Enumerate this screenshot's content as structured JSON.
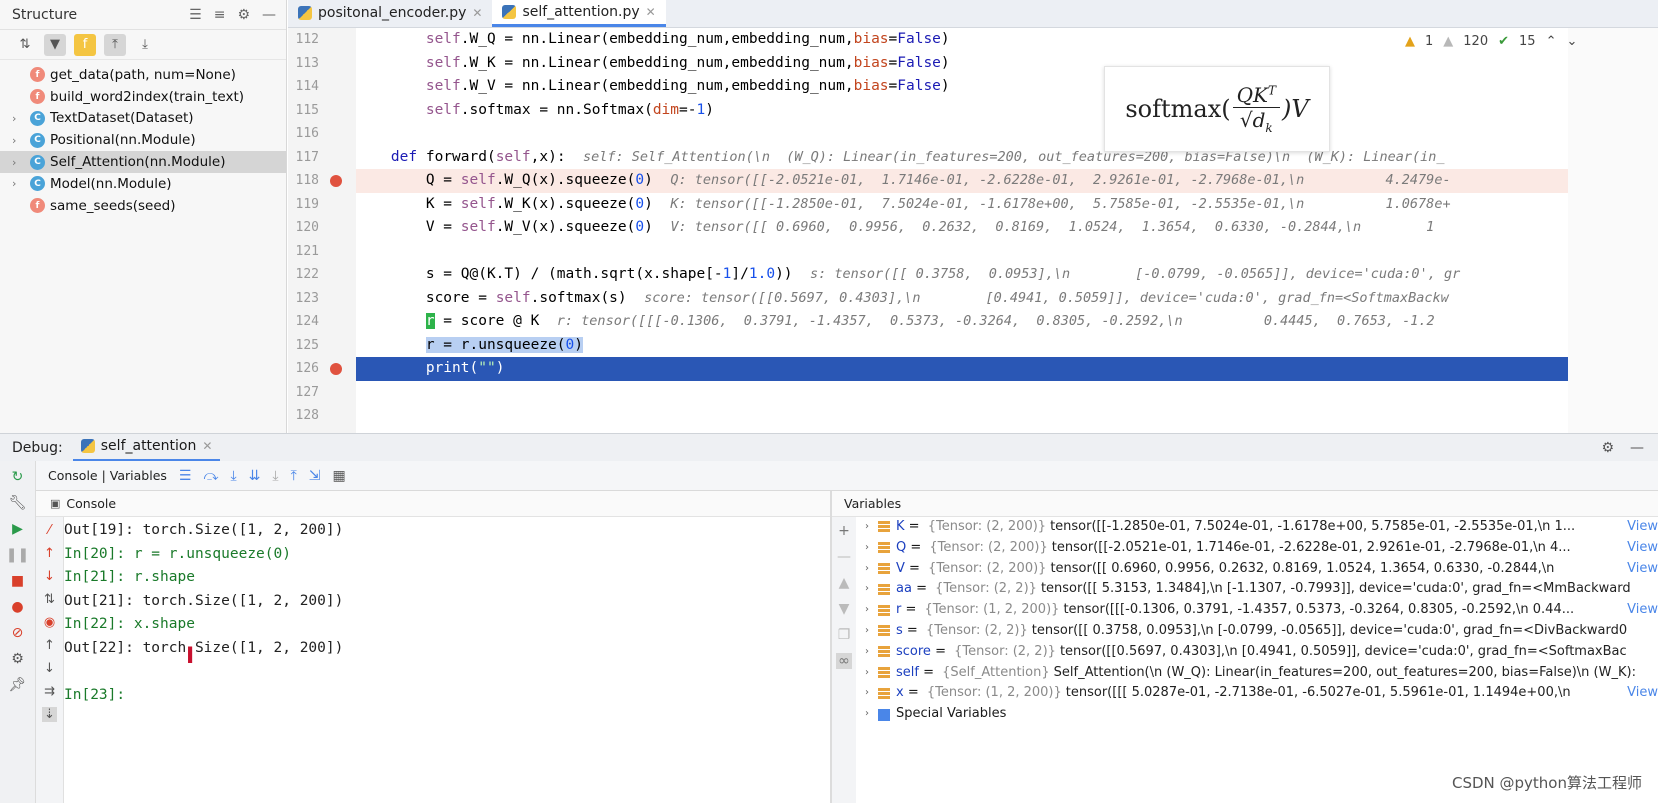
{
  "structure": {
    "title": "Structure",
    "items": [
      {
        "kind": "f",
        "label": "get_data(path, num=None)",
        "expand": ""
      },
      {
        "kind": "f",
        "label": "build_word2index(train_text)",
        "expand": ""
      },
      {
        "kind": "c",
        "label": "TextDataset(Dataset)",
        "expand": "›"
      },
      {
        "kind": "c",
        "label": "Positional(nn.Module)",
        "expand": "›"
      },
      {
        "kind": "c",
        "label": "Self_Attention(nn.Module)",
        "expand": "›"
      },
      {
        "kind": "c",
        "label": "Model(nn.Module)",
        "expand": "›"
      },
      {
        "kind": "f",
        "label": "same_seeds(seed)",
        "expand": ""
      }
    ]
  },
  "editor": {
    "tabs": [
      {
        "label": "positonal_encoder.py"
      },
      {
        "label": "self_attention.py"
      }
    ],
    "inspections": {
      "warnings": "1",
      "weak_warnings": "120",
      "ok": "15"
    },
    "line_numbers": [
      "112",
      "113",
      "114",
      "115",
      "116",
      "117",
      "118",
      "119",
      "120",
      "121",
      "122",
      "123",
      "124",
      "125",
      "126",
      "127",
      "128"
    ],
    "inline_values": {
      "forward": "self: Self_Attention(\\n  (W_Q): Linear(in_features=200, out_features=200, bias=False)\\n  (W_K): Linear(in_",
      "Q": "Q: tensor([[-2.0521e-01,  1.7146e-01, -2.6228e-01,  2.9261e-01, -2.7968e-01,\\n          4.2479e-",
      "K": "K: tensor([[-1.2850e-01,  7.5024e-01, -1.6178e+00,  5.7585e-01, -2.5535e-01,\\n          1.0678e+",
      "V": "V: tensor([[ 0.6960,  0.9956,  0.2632,  0.8169,  1.0524,  1.3654,  0.6330, -0.2844,\\n        1",
      "s": "s: tensor([[ 0.3758,  0.0953],\\n        [-0.0799, -0.0565]], device='cuda:0', gr",
      "score": "score: tensor([[0.5697, 0.4303],\\n        [0.4941, 0.5059]], device='cuda:0', grad_fn=<SoftmaxBackw",
      "r": "r: tensor([[[-0.1306,  0.3791, -1.4357,  0.5373, -0.3264,  0.8305, -0.2592,\\n          0.4445,  0.7653, -1.2"
    },
    "formula": {
      "word": "softmax(",
      "numerator": "QK",
      "sup": "T",
      "denominator": "√d",
      "sub": "k",
      "tail": ")V"
    }
  },
  "debug": {
    "label": "Debug:",
    "tab": "self_attention",
    "subbar": "Console | Variables",
    "console_header": "Console",
    "variables_header": "Variables",
    "console_lines": [
      {
        "type": "out",
        "text": "Out[19]: torch.Size([1, 2, 200])"
      },
      {
        "type": "in",
        "text": "In[20]: r = r.unsqueeze(0)"
      },
      {
        "type": "in",
        "text": "In[21]: r.shape"
      },
      {
        "type": "out",
        "text": "Out[21]: torch.Size([1, 2, 200])"
      },
      {
        "type": "in",
        "text": "In[22]: x.shape"
      },
      {
        "type": "out",
        "text": "Out[22]: torch.Size([1, 2, 200])"
      },
      {
        "type": "blank",
        "text": ""
      },
      {
        "type": "in",
        "text": "In[23]:"
      }
    ],
    "variables": [
      {
        "name": "K",
        "type": "{Tensor: (2, 200)}",
        "value": "tensor([[-1.2850e-01,  7.5024e-01, -1.6178e+00,  5.7585e-01, -2.5535e-01,\\n        1...",
        "view": "View"
      },
      {
        "name": "Q",
        "type": "{Tensor: (2, 200)}",
        "value": "tensor([[-2.0521e-01,  1.7146e-01, -2.6228e-01,  2.9261e-01, -2.7968e-01,\\n        4...",
        "view": "View"
      },
      {
        "name": "V",
        "type": "{Tensor: (2, 200)}",
        "value": "tensor([[ 0.6960,  0.9956,  0.2632,  0.8169,  1.0524,  1.3654,  0.6330, -0.2844,\\n",
        "view": "View"
      },
      {
        "name": "aa",
        "type": "{Tensor: (2, 2)}",
        "value": "tensor([[ 5.3153,  1.3484],\\n        [-1.1307, -0.7993]], device='cuda:0', grad_fn=<MmBackward",
        "view": ""
      },
      {
        "name": "r",
        "type": "{Tensor: (1, 2, 200)}",
        "value": "tensor([[[-0.1306,  0.3791, -1.4357,  0.5373, -0.3264,  0.8305, -0.2592,\\n          0.44...",
        "view": "View"
      },
      {
        "name": "s",
        "type": "{Tensor: (2, 2)}",
        "value": "tensor([[ 0.3758,  0.0953],\\n        [-0.0799, -0.0565]], device='cuda:0', grad_fn=<DivBackward0",
        "view": ""
      },
      {
        "name": "score",
        "type": "{Tensor: (2, 2)}",
        "value": "tensor([[0.5697, 0.4303],\\n        [0.4941, 0.5059]], device='cuda:0', grad_fn=<SoftmaxBac",
        "view": ""
      },
      {
        "name": "self",
        "type": "{Self_Attention}",
        "value": "Self_Attention(\\n  (W_Q): Linear(in_features=200, out_features=200, bias=False)\\n  (W_K):",
        "view": ""
      },
      {
        "name": "x",
        "type": "{Tensor: (1, 2, 200)}",
        "value": "tensor([[[ 5.0287e-01, -2.7138e-01, -6.5027e-01,  5.5961e-01,  1.1494e+00,\\n",
        "view": "View"
      }
    ],
    "special_variables": "Special Variables"
  },
  "watermark": "CSDN @python算法工程师",
  "colors": {
    "accent": "#4a86e8",
    "exec_line": "#2a57b5",
    "breakpoint": "#e0523f"
  }
}
